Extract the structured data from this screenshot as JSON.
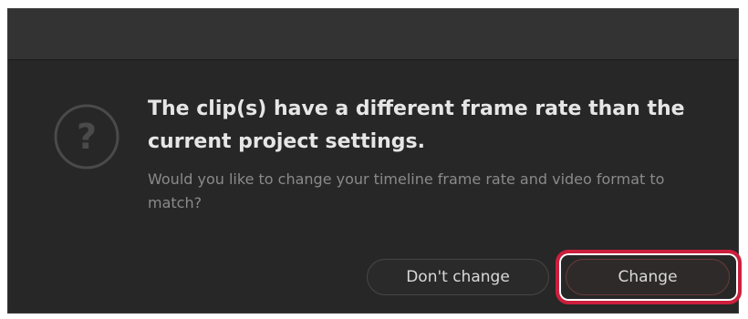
{
  "dialog": {
    "heading": "The clip(s) have a different frame rate than the current project settings.",
    "subtext": "Would you like to change your timeline frame rate and video format to match?",
    "icon": "question-mark-icon"
  },
  "buttons": {
    "dont_change_label": "Don't change",
    "change_label": "Change"
  },
  "colors": {
    "dialog_bg": "#272727",
    "titlebar_bg": "#333333",
    "heading_text": "#e6e6e6",
    "subtext": "#8a8a8a",
    "highlight": "#cc1f3d"
  }
}
